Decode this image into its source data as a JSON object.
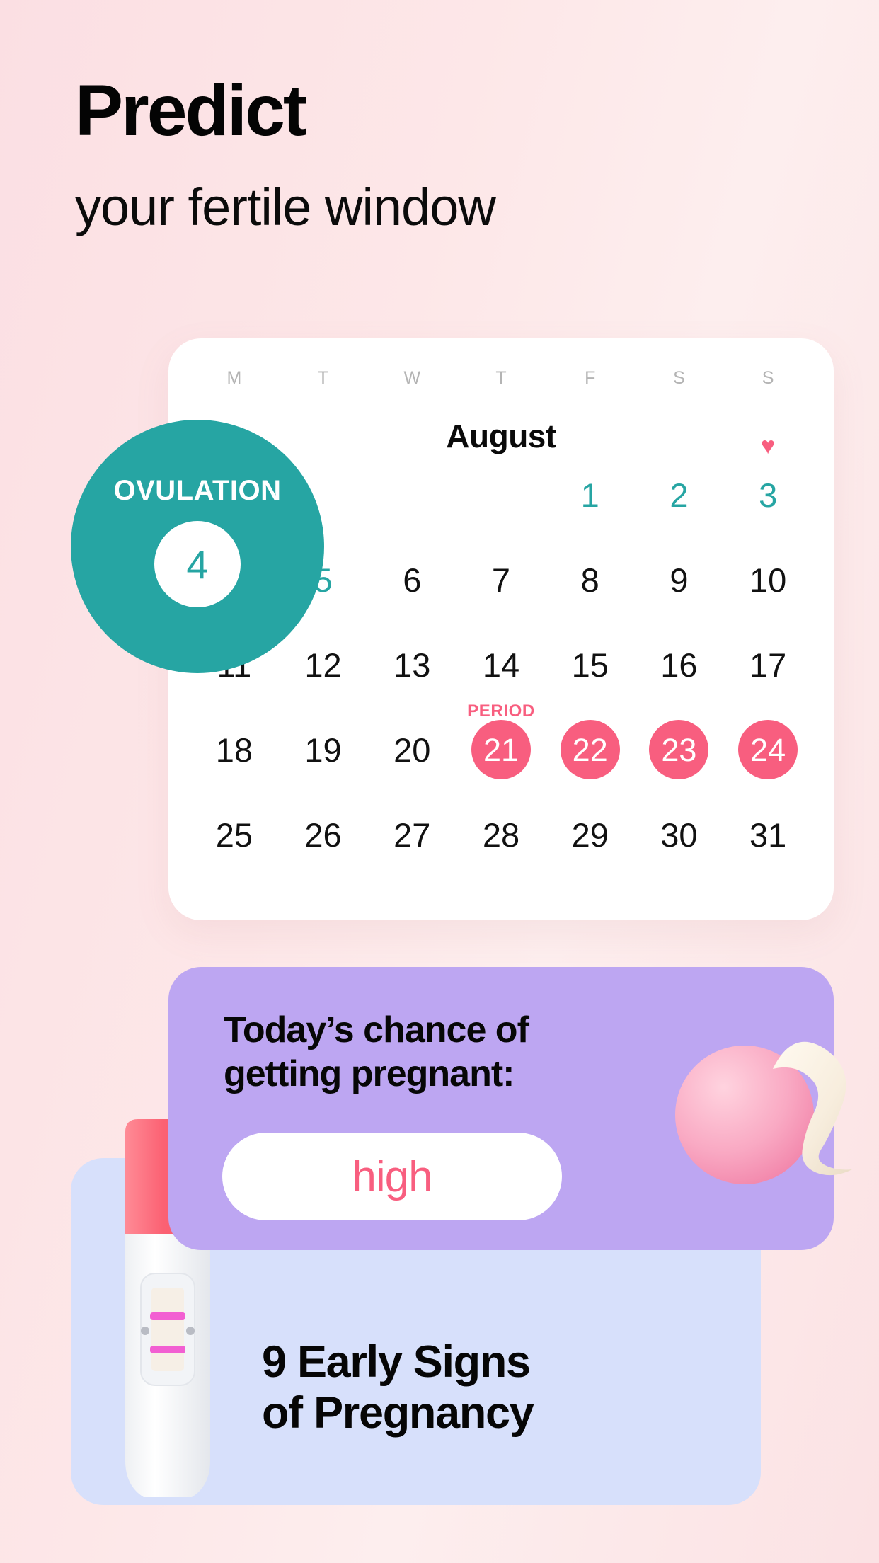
{
  "hero": {
    "headline": "Predict",
    "subhead": "your fertile window"
  },
  "calendar": {
    "month": "August",
    "weekdays": [
      "M",
      "T",
      "W",
      "T",
      "F",
      "S",
      "S"
    ],
    "period_label": "PERIOD",
    "heart_icon": "♥",
    "days": [
      {
        "n": "",
        "style": "empty"
      },
      {
        "n": "",
        "style": "empty"
      },
      {
        "n": "",
        "style": "empty"
      },
      {
        "n": "",
        "style": "empty"
      },
      {
        "n": "1",
        "style": "teal"
      },
      {
        "n": "2",
        "style": "teal"
      },
      {
        "n": "3",
        "style": "teal",
        "heart": true
      },
      {
        "n": "4",
        "style": "ovulation"
      },
      {
        "n": "5",
        "style": "teal"
      },
      {
        "n": "6",
        "style": "plain"
      },
      {
        "n": "7",
        "style": "plain"
      },
      {
        "n": "8",
        "style": "plain"
      },
      {
        "n": "9",
        "style": "plain"
      },
      {
        "n": "10",
        "style": "plain"
      },
      {
        "n": "11",
        "style": "plain"
      },
      {
        "n": "12",
        "style": "plain"
      },
      {
        "n": "13",
        "style": "plain"
      },
      {
        "n": "14",
        "style": "plain"
      },
      {
        "n": "15",
        "style": "plain"
      },
      {
        "n": "16",
        "style": "plain"
      },
      {
        "n": "17",
        "style": "plain"
      },
      {
        "n": "18",
        "style": "plain"
      },
      {
        "n": "19",
        "style": "plain"
      },
      {
        "n": "20",
        "style": "plain"
      },
      {
        "n": "21",
        "style": "period",
        "tag": "PERIOD"
      },
      {
        "n": "22",
        "style": "period"
      },
      {
        "n": "23",
        "style": "period"
      },
      {
        "n": "24",
        "style": "period"
      },
      {
        "n": "25",
        "style": "plain"
      },
      {
        "n": "26",
        "style": "plain"
      },
      {
        "n": "27",
        "style": "plain"
      },
      {
        "n": "28",
        "style": "plain"
      },
      {
        "n": "29",
        "style": "plain"
      },
      {
        "n": "30",
        "style": "plain"
      },
      {
        "n": "31",
        "style": "plain"
      }
    ]
  },
  "ovulation_badge": {
    "label": "OVULATION",
    "day": "4"
  },
  "chance_card": {
    "title_line1": "Today’s chance of",
    "title_line2": "getting pregnant:",
    "value": "high"
  },
  "article_card": {
    "line1": "9 Early Signs",
    "line2": "of Pregnancy"
  },
  "colors": {
    "teal": "#26a5a3",
    "pink": "#f85e7f",
    "lavender": "#bda6f2",
    "periwinkle": "#d7e0fb",
    "background_pink": "#fbdfe3"
  }
}
